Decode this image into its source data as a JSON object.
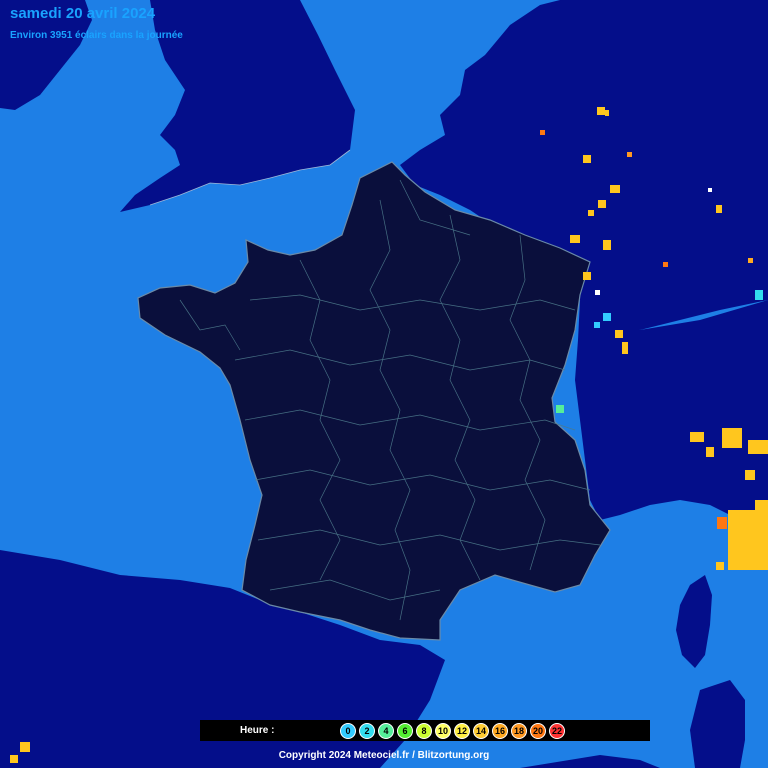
{
  "header": {
    "title": "samedi 20 avril 2024",
    "subtitle": "Environ 3951 éclairs dans la journée"
  },
  "legend": {
    "label": "Heure :",
    "hours": [
      {
        "value": "0",
        "color": "#33ccff"
      },
      {
        "value": "2",
        "color": "#33ddee"
      },
      {
        "value": "4",
        "color": "#55ee99"
      },
      {
        "value": "6",
        "color": "#55ee33"
      },
      {
        "value": "8",
        "color": "#ccff33"
      },
      {
        "value": "10",
        "color": "#ffff66"
      },
      {
        "value": "12",
        "color": "#ffee44"
      },
      {
        "value": "14",
        "color": "#ffcc33"
      },
      {
        "value": "16",
        "color": "#ffaa22"
      },
      {
        "value": "18",
        "color": "#ff9922"
      },
      {
        "value": "20",
        "color": "#ff7711"
      },
      {
        "value": "22",
        "color": "#ff3333"
      }
    ]
  },
  "footer": {
    "copyright": "Copyright 2024 Meteociel.fr / Blitzortung.org"
  },
  "colors": {
    "sea": "#1e7fe6",
    "land": "#040e8a",
    "france": "#0a0f3c",
    "title": "#19a3ff",
    "lightning_recent": "#ffc61e"
  }
}
